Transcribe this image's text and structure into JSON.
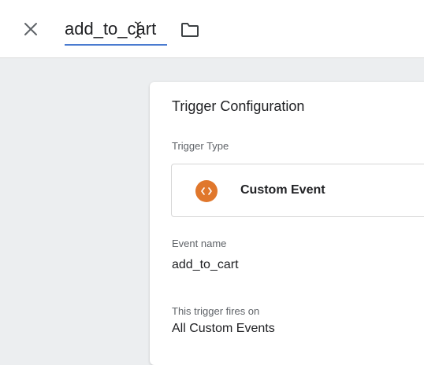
{
  "header": {
    "close_icon": "close-icon",
    "tag_name": "add_to_cart",
    "folder_icon": "folder-icon"
  },
  "card": {
    "title": "Trigger Configuration",
    "trigger_type_label": "Trigger Type",
    "trigger_type": {
      "name": "Custom Event",
      "icon": "custom-event-icon",
      "icon_color": "#e0772c"
    },
    "event_name_label": "Event name",
    "event_name": "add_to_cart",
    "fires_on_label": "This trigger fires on",
    "fires_on": "All Custom Events"
  },
  "colors": {
    "accent_underline": "#4a7bd0",
    "background": "#eceef0"
  }
}
